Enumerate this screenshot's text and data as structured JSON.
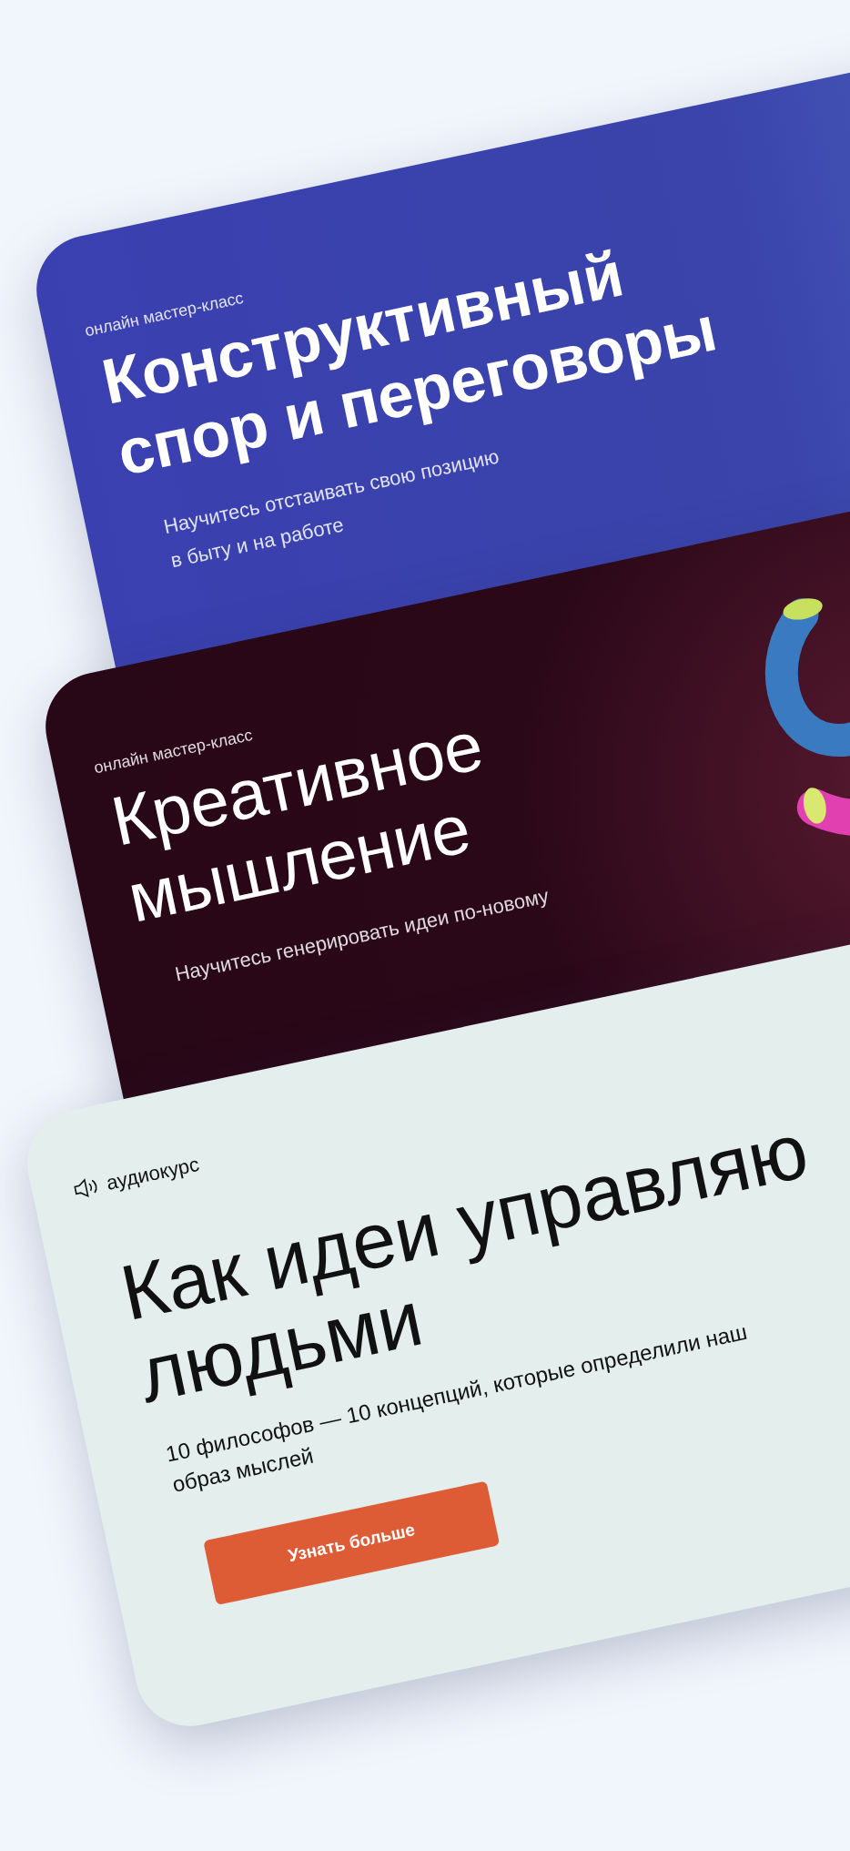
{
  "cards": [
    {
      "kind": "bold",
      "tag": "онлайн мастер-класс",
      "title": [
        "Конструктивный",
        "спор и переговоры"
      ],
      "subtitle": [
        "Научитесь отстаивать свою позицию",
        "в быту и на работе"
      ]
    },
    {
      "kind": "dark",
      "tag": "онлайн мастер-класс",
      "title": [
        "Креативное",
        "мышление"
      ],
      "subtitle": [
        "Научитесь генерировать идеи по-новому"
      ]
    },
    {
      "kind": "audio",
      "tag": "аудиокурс",
      "title": [
        "Как идеи управляю",
        "людьми"
      ],
      "subtitle": [
        "10 философов — 10 концепций, которые определили наш",
        "образ мыслей"
      ],
      "button": "Узнать больше"
    }
  ]
}
